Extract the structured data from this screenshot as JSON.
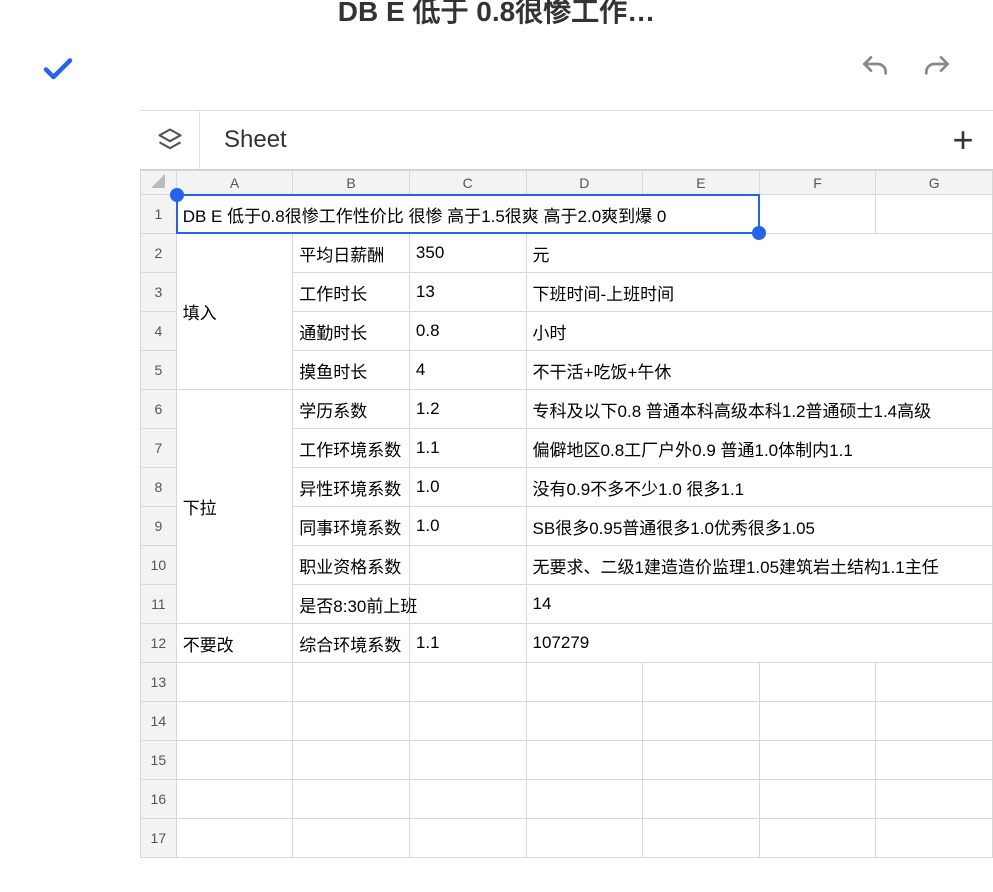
{
  "header": {
    "title_fragment": "DB E 低于 0.8很惨工作…"
  },
  "tabs": {
    "sheet_label": "Sheet"
  },
  "columns": [
    "A",
    "B",
    "C",
    "D",
    "E",
    "F",
    "G"
  ],
  "row_numbers": [
    "1",
    "2",
    "3",
    "4",
    "5",
    "6",
    "7",
    "8",
    "9",
    "10",
    "11",
    "12",
    "13",
    "14",
    "15",
    "16",
    "17"
  ],
  "cells": {
    "r1": {
      "merged_text": "DB E 低于0.8很惨工作性价比 很惨 高于1.5很爽 高于2.0爽到爆 0"
    },
    "r2": {
      "A": "",
      "B": "平均日薪酬",
      "C": "350",
      "D": "元"
    },
    "r3": {
      "A": "填入",
      "B": "工作时长",
      "C": "13",
      "D": "下班时间-上班时间"
    },
    "r4": {
      "B": "通勤时长",
      "C": "0.8",
      "D": "小时"
    },
    "r5": {
      "B": "摸鱼时长",
      "C": "4",
      "D": "不干活+吃饭+午休"
    },
    "r6": {
      "A": "",
      "B": "学历系数",
      "C": "1.2",
      "D": "专科及以下0.8 普通本科高级本科1.2普通硕士1.4高级"
    },
    "r7": {
      "A": "下拉",
      "B": "工作环境系数",
      "C": "1.1",
      "D": "偏僻地区0.8工厂户外0.9 普通1.0体制内1.1"
    },
    "r8": {
      "B": "异性环境系数",
      "C": "1.0",
      "D": "没有0.9不多不少1.0 很多1.1"
    },
    "r9": {
      "B": "同事环境系数",
      "C": "1.0",
      "D": "SB很多0.95普通很多1.0优秀很多1.05"
    },
    "r10": {
      "B": "职业资格系数",
      "C": "",
      "D": "无要求、二级1建造造价监理1.05建筑岩土结构1.1主任"
    },
    "r11": {
      "B": "是否8:30前上班",
      "C": "",
      "D": "14"
    },
    "r12": {
      "A": "不要改",
      "B": "综合环境系数",
      "C": "1.1",
      "D": "107279"
    }
  }
}
